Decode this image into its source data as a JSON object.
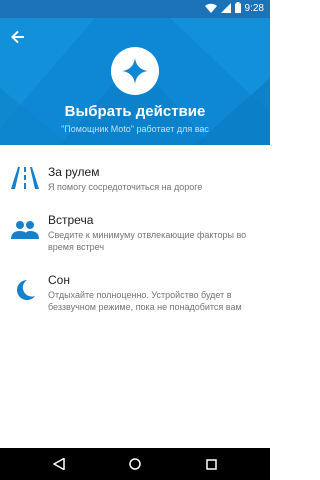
{
  "status_bar": {
    "time": "9:28",
    "icons": [
      "wifi-icon",
      "signal-icon",
      "battery-icon"
    ]
  },
  "header": {
    "back_icon": "arrow-back-icon",
    "logo_icon": "moto-assistant-star-icon",
    "title": "Выбрать действие",
    "subtitle": "\"Помощник Moto\" работает для вас"
  },
  "actions": [
    {
      "icon": "road-icon",
      "title": "За рулем",
      "description": "Я помогу сосредоточиться на дороге"
    },
    {
      "icon": "people-icon",
      "title": "Встреча",
      "description": "Сведите к минимуму отвлекающие факторы во время встреч"
    },
    {
      "icon": "moon-icon",
      "title": "Сон",
      "description": "Отдыхайте полноценно. Устройство будет в беззвучном режиме, пока не понадобится вам"
    }
  ],
  "nav_bar": {
    "buttons": [
      "back-triangle-icon",
      "home-circle-icon",
      "recents-square-icon"
    ]
  },
  "colors": {
    "header_bg": "#0e88d4",
    "status_bar_bg": "#1a73b8",
    "accent_icon": "#1581cc",
    "nav_bg": "#000000"
  }
}
